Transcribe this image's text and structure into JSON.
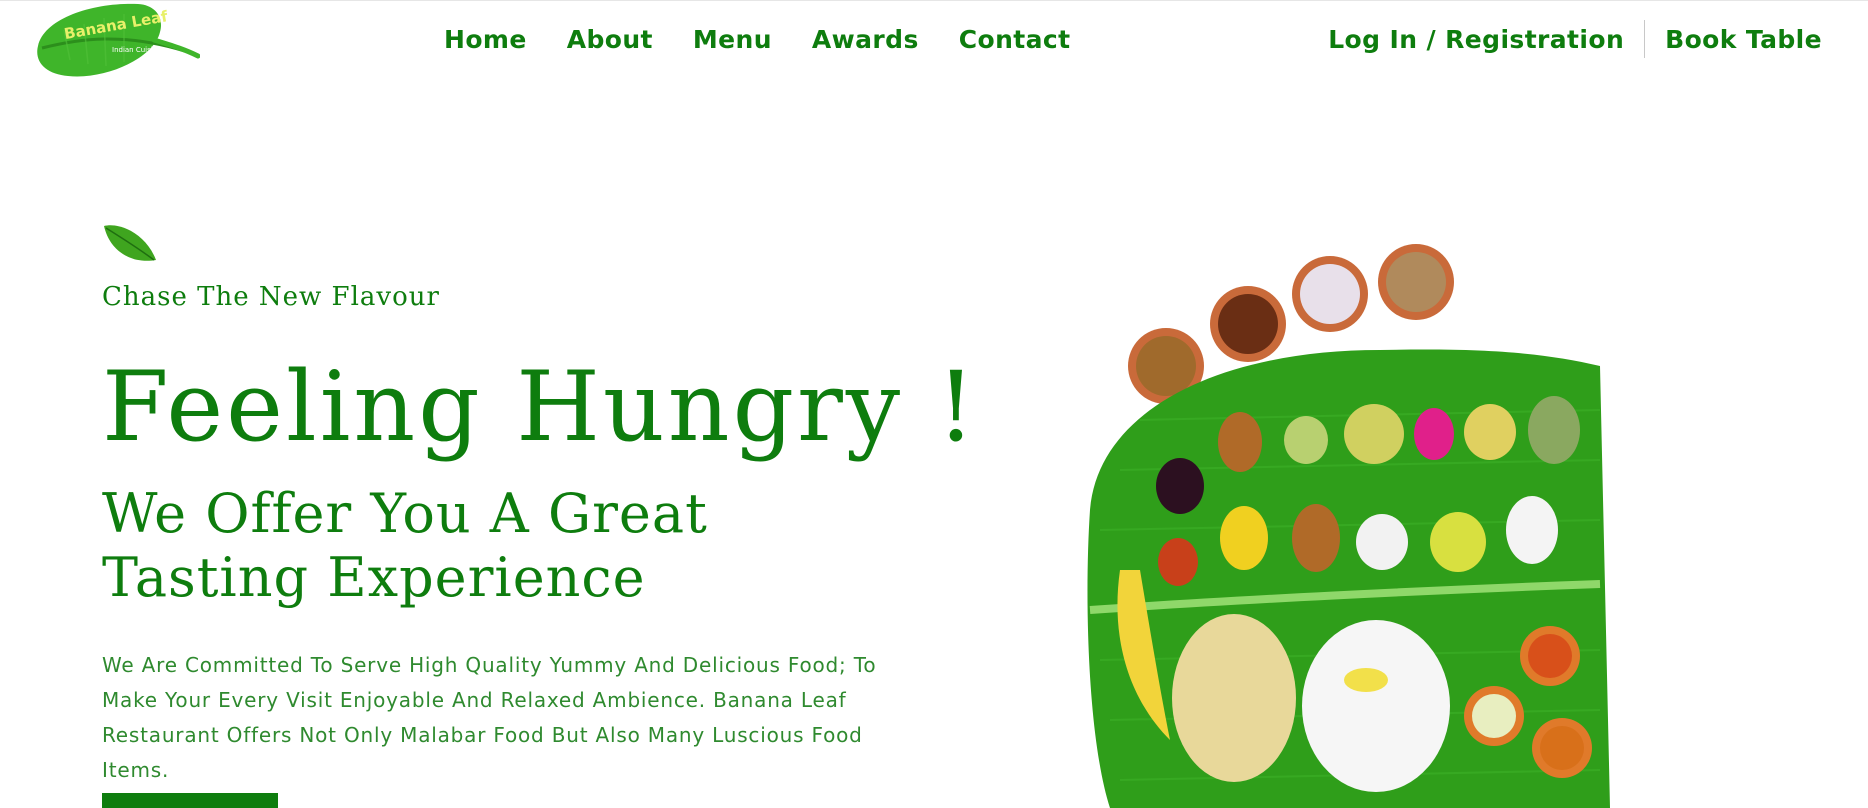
{
  "brand": {
    "name": "Banana Leaf",
    "tagline": "Indian Cuisine"
  },
  "nav": {
    "items": [
      {
        "label": "Home"
      },
      {
        "label": "About"
      },
      {
        "label": "Menu"
      },
      {
        "label": "Awards"
      },
      {
        "label": "Contact"
      }
    ],
    "login_label": "Log In / Registration",
    "book_label": "Book Table"
  },
  "hero": {
    "kicker": "Chase The New Flavour",
    "headline": "Feeling Hungry !",
    "subheadline": "We Offer You A Great Tasting Experience",
    "description": "We Are Committed To Serve High Quality Yummy And Delicious Food; To Make Your Every Visit Enjoyable And Relaxed Ambience. Banana Leaf Restaurant Offers Not Only Malabar Food But Also Many Luscious Food Items."
  },
  "colors": {
    "primary_green": "#0e7d0e",
    "leaf_green": "#2f9e1a",
    "background": "#ffffff"
  }
}
